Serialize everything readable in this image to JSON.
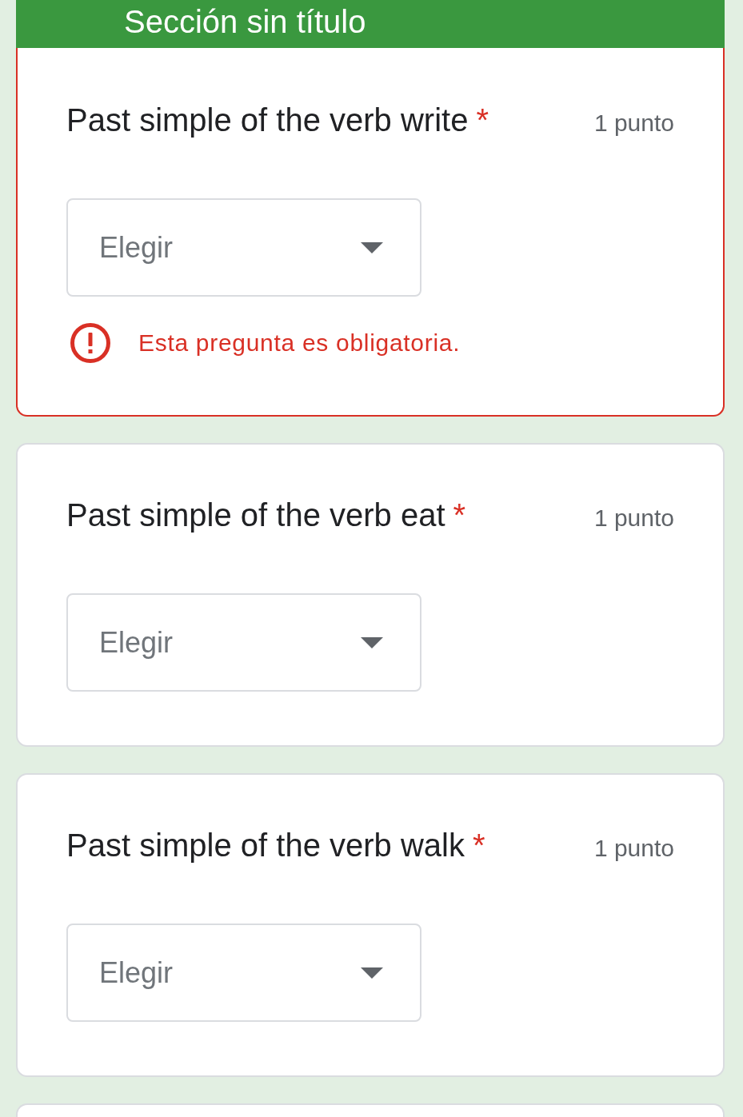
{
  "section": {
    "title": "Sección sin título"
  },
  "questions": [
    {
      "title": "Past simple of the verb write",
      "required_mark": "*",
      "points": "1 punto",
      "dropdown": {
        "placeholder": "Elegir"
      },
      "error": "Esta pregunta es obligatoria."
    },
    {
      "title": "Past simple of the verb eat",
      "required_mark": "*",
      "points": "1 punto",
      "dropdown": {
        "placeholder": "Elegir"
      }
    },
    {
      "title": "Past simple of the verb walk",
      "required_mark": "*",
      "points": "1 punto",
      "dropdown": {
        "placeholder": "Elegir"
      }
    }
  ]
}
